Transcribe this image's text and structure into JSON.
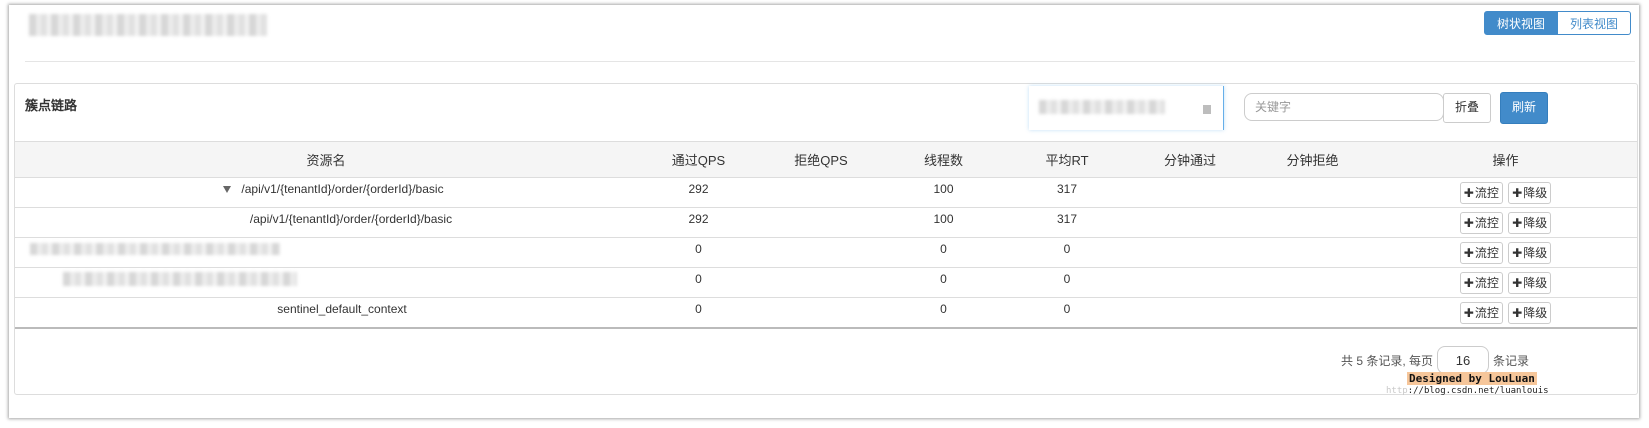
{
  "header": {
    "view_tree": "树状视图",
    "view_list": "列表视图"
  },
  "panel": {
    "title": "簇点链路",
    "search_placeholder": "关键字",
    "fold_label": "折叠",
    "refresh_label": "刷新"
  },
  "table": {
    "columns": [
      "资源名",
      "通过QPS",
      "拒绝QPS",
      "线程数",
      "平均RT",
      "分钟通过",
      "分钟拒绝",
      "操作"
    ],
    "rows": [
      {
        "resource": "/api/v1/{tenantId}/order/{orderId}/basic",
        "pass_qps": "292",
        "block_qps": "",
        "threads": "100",
        "avg_rt": "317",
        "min_pass": "",
        "min_block": ""
      },
      {
        "resource": "/api/v1/{tenantId}/order/{orderId}/basic",
        "pass_qps": "292",
        "block_qps": "",
        "threads": "100",
        "avg_rt": "317",
        "min_pass": "",
        "min_block": ""
      },
      {
        "resource": "",
        "pass_qps": "0",
        "block_qps": "",
        "threads": "0",
        "avg_rt": "0",
        "min_pass": "",
        "min_block": ""
      },
      {
        "resource": "",
        "pass_qps": "0",
        "block_qps": "",
        "threads": "0",
        "avg_rt": "0",
        "min_pass": "",
        "min_block": ""
      },
      {
        "resource": "sentinel_default_context",
        "pass_qps": "0",
        "block_qps": "",
        "threads": "0",
        "avg_rt": "0",
        "min_pass": "",
        "min_block": ""
      }
    ],
    "action_flow": "流控",
    "action_degrade": "降级",
    "plus": "✚"
  },
  "footer": {
    "total_text": "共 5 条记录, 每页",
    "page_size": "16",
    "suffix": "条记录"
  },
  "watermark": {
    "designed": "Designed by LouLuan",
    "url_ghost": "http",
    "url": "://blog.csdn.net/luanlouis"
  }
}
